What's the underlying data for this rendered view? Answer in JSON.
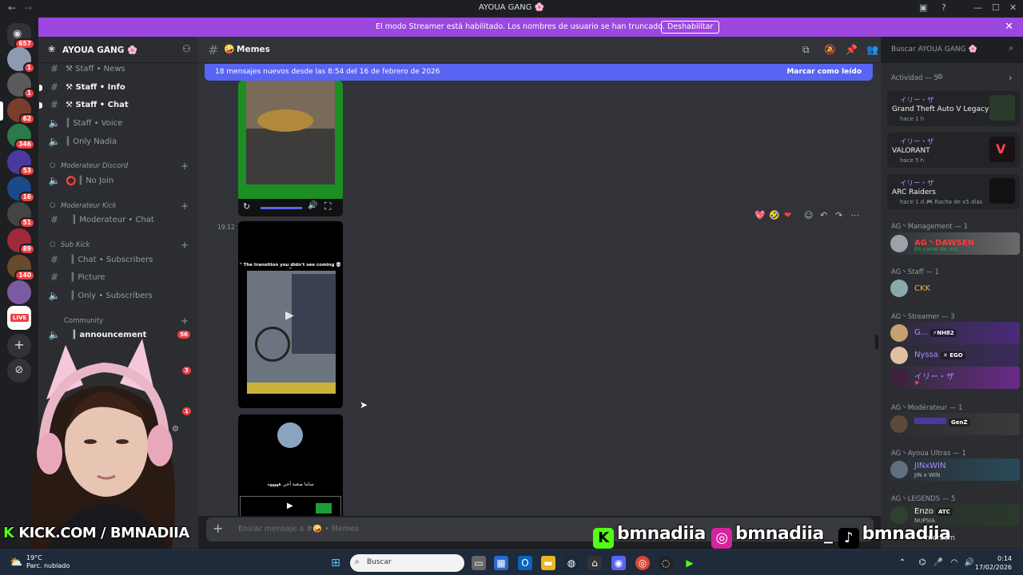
{
  "window": {
    "title": "AYOUA GANG 🌸"
  },
  "streamer_banner": {
    "message": "El modo Streamer está habilitado. Los nombres de usuario se han truncado.",
    "button": "Deshabilitar"
  },
  "server_rail": {
    "badges": [
      "657",
      "1",
      "1",
      "62",
      "346",
      "53",
      "16",
      "51",
      "89",
      "140"
    ],
    "live_label": "LIVE"
  },
  "server": {
    "name": "AYOUA GANG 🌸"
  },
  "channels": [
    {
      "label": "⚒ Staff • News",
      "icon": "hash",
      "bold": false
    },
    {
      "label": "⚒ Staff • Info",
      "icon": "hash",
      "bold": true
    },
    {
      "label": "⚒ Staff • Chat",
      "icon": "hash",
      "bold": true
    },
    {
      "label": "║ Staff • Voice",
      "icon": "speaker",
      "bold": false
    },
    {
      "label": "║ Only Nadia",
      "icon": "speaker",
      "bold": false
    },
    {
      "label": "║ No Join",
      "icon": "speaker",
      "bold": false
    },
    {
      "label": "║ Moderateur • Chat",
      "icon": "hash",
      "bold": false
    },
    {
      "label": "║ Chat • Subscribers",
      "icon": "hash",
      "bold": false
    },
    {
      "label": "║ Picture",
      "icon": "hash",
      "bold": false
    },
    {
      "label": "║ Only • Subscribers",
      "icon": "speaker",
      "bold": false
    },
    {
      "label": "║ announcement",
      "icon": "speaker",
      "bold": true,
      "count": "56"
    }
  ],
  "categories": [
    "Moderateur Discord",
    "Moderateur Kick",
    "Sub Kick",
    "Community"
  ],
  "extra_badges": [
    "3",
    "1"
  ],
  "channel_header": {
    "name": "Memes"
  },
  "search": {
    "placeholder": "Buscar AYOUA GANG 🌸"
  },
  "new_messages": {
    "text": "18 mensajes nuevos desde las 8:54 del 16 de febrero de 2026",
    "action": "Marcar como leído"
  },
  "messages": [
    {
      "timestamp": "19:12",
      "video_caption": "\" The transition you didn't see coming 💀 \""
    },
    {
      "timestamp": "",
      "video_caption": "ساما صعبة أجي هههههه"
    }
  ],
  "composer": {
    "placeholder": "Enviar mensaje a #🤪 • Memes"
  },
  "activity": {
    "header": "Actividad — 5",
    "cards": [
      {
        "user": "イリー・ザ",
        "game": "Grand Theft Auto V Legacy",
        "when": "hace 1 h"
      },
      {
        "user": "イリー・ザ",
        "game": "VALORANT",
        "when": "hace 5 h"
      },
      {
        "user": "イリー・ザ",
        "game": "ARC Raiders",
        "when": "hace 1 d   🎮 Racha de x5 días"
      }
    ]
  },
  "member_groups": [
    {
      "title": "AG丶Management — 1",
      "members": [
        {
          "name": "AG丶DAWSEN",
          "sub": "En canal de voz",
          "color": "#f23f43"
        }
      ]
    },
    {
      "title": "AG丶Staff — 1",
      "members": [
        {
          "name": "CKK",
          "sub": "",
          "color": "#f0b232"
        }
      ]
    },
    {
      "title": "AG丶Streamer — 3",
      "members": [
        {
          "name": "G...",
          "tag": "⚡NH82",
          "sub": "",
          "color": "#a78bfa"
        },
        {
          "name": "Nyssa",
          "tag": "✕ EGO",
          "sub": "",
          "color": "#a78bfa"
        },
        {
          "name": "イリー・ザ",
          "sub": "♥",
          "color": "#a78bfa"
        }
      ]
    },
    {
      "title": "AG丶Modérateur — 1",
      "members": [
        {
          "name": "",
          "tag": "GenZ",
          "sub": "",
          "color": "#5865f2"
        }
      ]
    },
    {
      "title": "AG丶Ayoua Ultras — 1",
      "members": [
        {
          "name": "JINxWIN",
          "sub": "JIN x WIN",
          "color": "#a78bfa"
        }
      ]
    },
    {
      "title": "AG丶LEGENDS — 5",
      "members": [
        {
          "name": "Enzo",
          "tag": "ATC",
          "sub": "NUPSIA",
          "color": "#f2f3f5"
        }
      ]
    }
  ],
  "overlay": {
    "kick": "KICK.COM / BMNADIIA",
    "kick_handle": "bmnadiia",
    "instagram_handle": "bmnadiia_",
    "tiktok_handle": "bmnadiia",
    "member_peek": "mersem"
  },
  "taskbar": {
    "temp": "19°C",
    "weather": "Parc. nublado",
    "search_placeholder": "Buscar",
    "time": "0:14",
    "date": "17/02/2026"
  },
  "colors": {
    "accent": "#5865f2",
    "streamer": "#9b47e0",
    "kick": "#53fc18"
  }
}
